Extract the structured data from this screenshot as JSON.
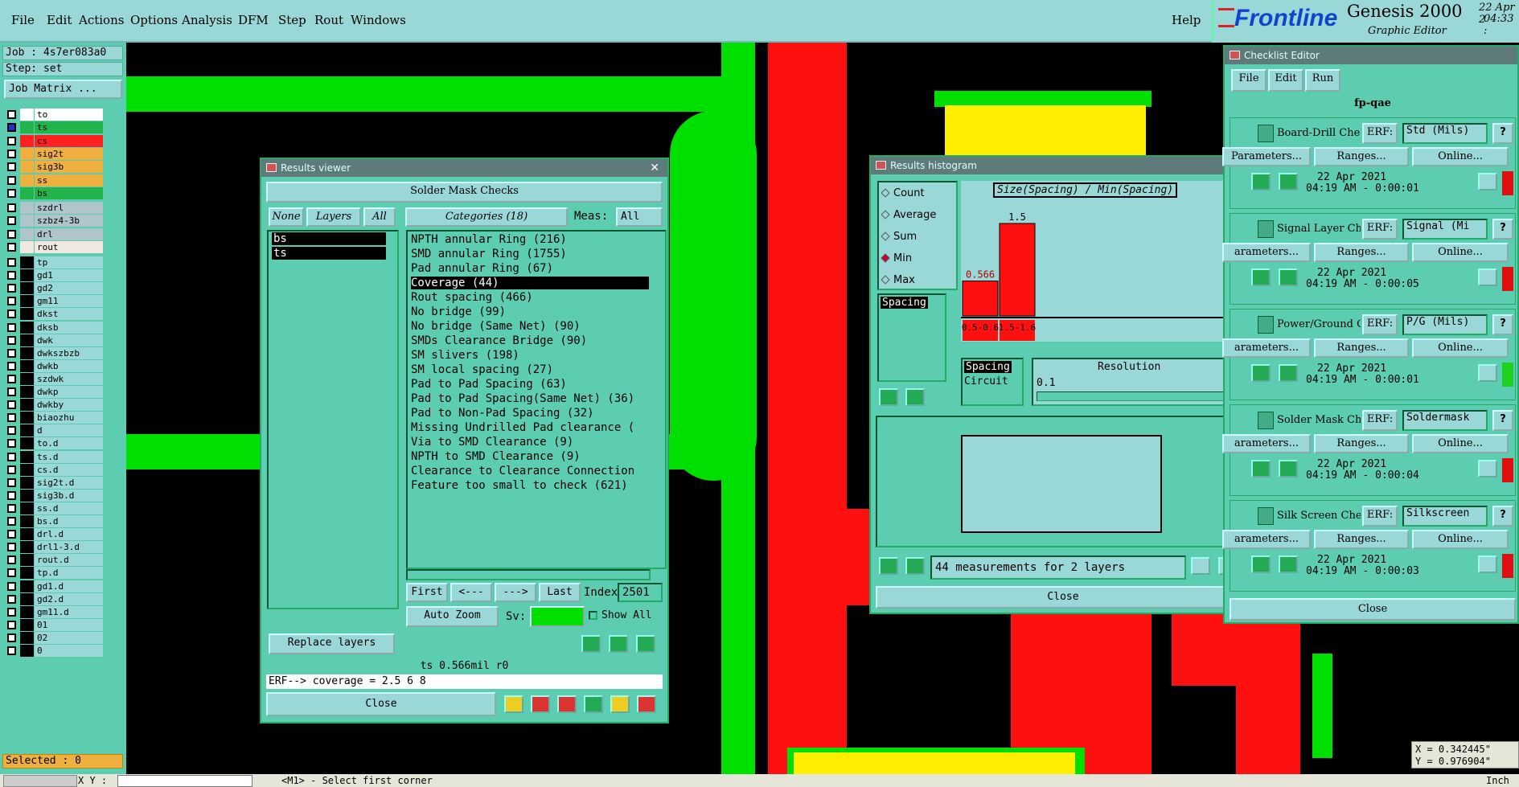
{
  "menubar": {
    "items": [
      "File",
      "Edit",
      "Actions",
      "Options",
      "Analysis",
      "DFM",
      "Step",
      "Rout",
      "Windows"
    ],
    "help": "Help"
  },
  "brand": {
    "logo": "Frontline",
    "product": "Genesis 2000",
    "subtitle": "Graphic Editor",
    "date": "22 Apr 2",
    "time": "04:33 :"
  },
  "job": {
    "job": "Job : 4s7er083a0",
    "step": "Step: set",
    "matrix": "Job Matrix ..."
  },
  "layers_group1": [
    {
      "name": "to",
      "color": "#ffffff"
    },
    {
      "name": "ts",
      "color": "#22b44a",
      "selected": true
    },
    {
      "name": "cs",
      "color": "#ff2020"
    },
    {
      "name": "sig2t",
      "color": "#f0b040"
    },
    {
      "name": "sig3b",
      "color": "#f0b040"
    },
    {
      "name": "ss",
      "color": "#f0b040"
    },
    {
      "name": "bs",
      "color": "#22b44a"
    }
  ],
  "layers_group2": [
    "szdrl",
    "szbz4-3b",
    "drl",
    "rout"
  ],
  "layers_group3": [
    "tp",
    "gd1",
    "gd2",
    "gm11",
    "dkst",
    "dksb",
    "dwk",
    "dwkszbzb",
    "dwkb",
    "szdwk",
    "dwkp",
    "dwkby",
    "biaozhu",
    "d",
    "to.d",
    "ts.d",
    "cs.d",
    "sig2t.d",
    "sig3b.d",
    "ss.d",
    "bs.d",
    "drl.d",
    "drl1-3.d",
    "rout.d",
    "tp.d",
    "gd1.d",
    "gd2.d",
    "gm11.d",
    "01",
    "02",
    "0"
  ],
  "selected": "Selected : 0",
  "statusbar": {
    "xy": "X Y :",
    "msg": "<M1> - Select first corner",
    "unit": "Inch"
  },
  "coords": {
    "x": "X = 0.342445\"",
    "y": "Y = 0.976904\""
  },
  "results_viewer": {
    "title": "Results viewer",
    "header": "Solder Mask Checks",
    "none": "None",
    "layers": "Layers",
    "all": "All",
    "categories": "Categories (18)",
    "meas_label": "Meas:",
    "meas_value": "All",
    "layer_list": [
      "bs",
      "ts"
    ],
    "category_list": [
      "NPTH annular Ring (216)",
      "SMD annular Ring (1755)",
      "Pad annular Ring (67)",
      "Coverage (44)",
      "Rout spacing (466)",
      "No bridge (99)",
      "No bridge (Same Net) (90)",
      "SMDs Clearance Bridge (90)",
      "SM slivers (198)",
      "SM local spacing (27)",
      "Pad to Pad Spacing (63)",
      "Pad to Pad Spacing(Same Net) (36)",
      "Pad to Non-Pad Spacing (32)",
      "Missing Undrilled Pad clearance (",
      "Via to SMD Clearance (9)",
      "NPTH to SMD Clearance (9)",
      "Clearance to Clearance Connection",
      "Feature too small to check (621)"
    ],
    "nav": {
      "first": "First",
      "prev": "<---",
      "next": "--->",
      "last": "Last",
      "index_label": "Index:",
      "index": "2501"
    },
    "auto_zoom": "Auto Zoom",
    "sv": "Sv:",
    "show_all": "Show All",
    "replace_layers": "Replace layers",
    "status": "ts 0.566mil  r0",
    "erf": "ERF--> coverage = 2.5 6 8",
    "close": "Close"
  },
  "histogram": {
    "title": "Results histogram",
    "options": [
      "Count",
      "Average",
      "Sum",
      "Min",
      "Max"
    ],
    "selected_option": "Min",
    "plot_title": "Size(Spacing) / Min(Spacing)",
    "param": "Spacing",
    "circuit": "Circuit",
    "resolution_label": "Resolution",
    "resolution": "0.1",
    "measurements": "44 measurements for 2 layers",
    "close": "Close"
  },
  "chart_data": {
    "type": "bar",
    "categories": [
      "0.5-0.6",
      "1.5-1.6"
    ],
    "values": [
      0.566,
      1.5
    ],
    "title": "Size(Spacing) / Min(Spacing)",
    "xlabel": "",
    "ylabel": ""
  },
  "checklist": {
    "title": "Checklist Editor",
    "menu": [
      "File",
      "Edit",
      "Run"
    ],
    "name": "fp-qae",
    "checks": [
      {
        "name": "Board-Drill Che",
        "erf": "ERF:",
        "erf_val": "Std (Mils)",
        "params": "Parameters...",
        "ranges": "Ranges...",
        "online": "Online...",
        "date": "22 Apr 2021",
        "time": "04:19 AM - 0:00:01",
        "status": "#e01010"
      },
      {
        "name": "Signal Layer Ch",
        "erf": "ERF:",
        "erf_val": "Signal (Mi",
        "params": "arameters...",
        "ranges": "Ranges...",
        "online": "Online...",
        "date": "22 Apr 2021",
        "time": "04:19 AM - 0:00:05",
        "status": "#e01010"
      },
      {
        "name": "Power/Ground C",
        "erf": "ERF:",
        "erf_val": "P/G (Mils)",
        "params": "arameters...",
        "ranges": "Ranges...",
        "online": "Online...",
        "date": "22 Apr 2021",
        "time": "04:19 AM - 0:00:01",
        "status": "#20d020"
      },
      {
        "name": "Solder Mask Che",
        "erf": "ERF:",
        "erf_val": "Soldermask",
        "params": "arameters...",
        "ranges": "Ranges...",
        "online": "Online...",
        "date": "22 Apr 2021",
        "time": "04:19 AM - 0:00:04",
        "status": "#e01010"
      },
      {
        "name": "Silk Screen Che",
        "erf": "ERF:",
        "erf_val": "Silkscreen",
        "params": "arameters...",
        "ranges": "Ranges...",
        "online": "Online...",
        "date": "22 Apr 2021",
        "time": "04:19 AM - 0:00:03",
        "status": "#e01010"
      }
    ],
    "close": "Close"
  }
}
